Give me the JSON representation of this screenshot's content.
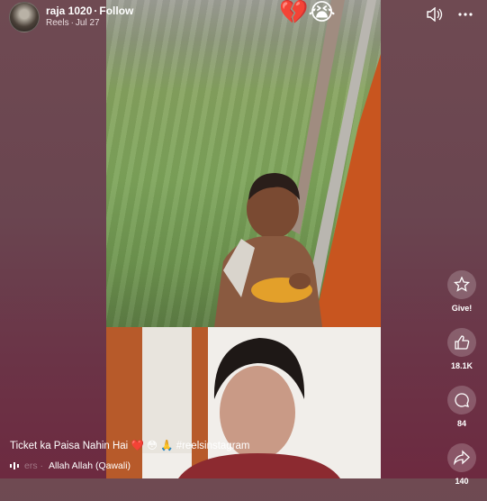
{
  "header": {
    "username": "raja 1020",
    "follow_label": "Follow",
    "source": "Reels",
    "date": "Jul 27"
  },
  "overlay_emojis": "💔😭",
  "actions": {
    "give_label": "Give!",
    "likes": "18.1K",
    "comments": "84",
    "shares": "140"
  },
  "caption": {
    "text": "Ticket ka Paisa Nahin Hai",
    "emojis": "❤️ 😳 🙏",
    "hashtag": "#reelsinstagram"
  },
  "audio": {
    "faded_prefix": "ers ·",
    "track": "Allah Allah (Qawali)"
  },
  "colors": {
    "background_top": "#6f4a52",
    "background_bottom": "#6d2a40"
  },
  "icons": [
    "avatar",
    "volume-icon",
    "more-icon",
    "give-icon",
    "like-icon",
    "comment-icon",
    "share-icon",
    "audio-icon"
  ]
}
